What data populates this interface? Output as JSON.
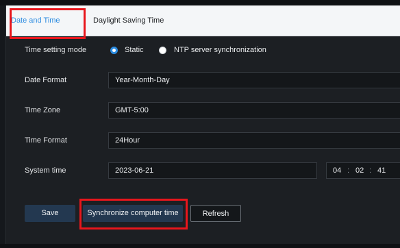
{
  "tabs": [
    {
      "label": "Date and Time"
    },
    {
      "label": "Daylight Saving Time"
    }
  ],
  "time_setting_mode": {
    "label": "Time setting mode",
    "options": [
      {
        "label": "Static",
        "selected": true
      },
      {
        "label": "NTP server synchronization",
        "selected": false
      }
    ]
  },
  "date_format": {
    "label": "Date Format",
    "value": "Year-Month-Day"
  },
  "time_zone": {
    "label": "Time Zone",
    "value": "GMT-5:00"
  },
  "time_format": {
    "label": "Time Format",
    "value": "24Hour"
  },
  "system_time": {
    "label": "System time",
    "date": "2023-06-21",
    "hour": "04",
    "minute": "02",
    "second": "41",
    "separator": ":"
  },
  "buttons": {
    "save": "Save",
    "sync": "Synchronize computer time",
    "refresh": "Refresh"
  },
  "colors": {
    "accent": "#2b8be0",
    "highlight": "#e8161c",
    "primary_button": "#233850"
  }
}
